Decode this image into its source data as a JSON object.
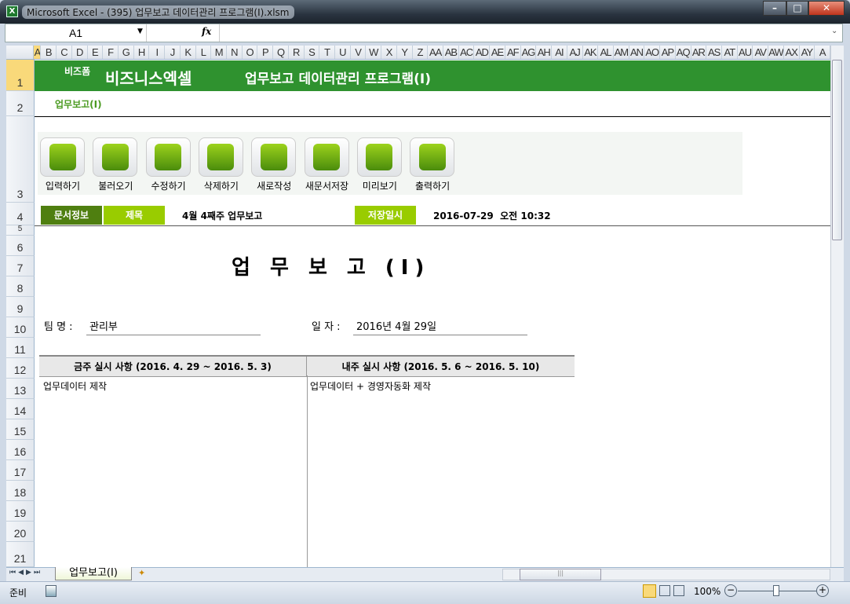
{
  "window": {
    "title": "Microsoft Excel - (395) 업무보고 데이터관리 프로그램(Ⅰ).xlsm",
    "app_icon": "X",
    "minimize": "–",
    "maximize": "□",
    "close": "✕"
  },
  "formula_bar": {
    "name_box": "A1",
    "fx": "fx",
    "formula": ""
  },
  "columns": [
    "A",
    "B",
    "C",
    "D",
    "E",
    "F",
    "G",
    "H",
    "I",
    "J",
    "K",
    "L",
    "M",
    "N",
    "O",
    "P",
    "Q",
    "R",
    "S",
    "T",
    "U",
    "V",
    "W",
    "X",
    "Y",
    "Z",
    "AA",
    "AB",
    "AC",
    "AD",
    "AE",
    "AF",
    "AG",
    "AH",
    "AI",
    "AJ",
    "AK",
    "AL",
    "AM",
    "AN",
    "AO",
    "AP",
    "AQ",
    "AR",
    "AS",
    "AT",
    "AU",
    "AV",
    "AW",
    "AX",
    "AY",
    "A"
  ],
  "rows": [
    "1",
    "2",
    "3",
    "4",
    "5",
    "6",
    "7",
    "8",
    "9",
    "10",
    "11",
    "12",
    "13",
    "14",
    "15",
    "16",
    "17",
    "18",
    "19",
    "20",
    "21"
  ],
  "header": {
    "small": "비즈폼",
    "brand": "비즈니스엑셀",
    "title": "업무보고 데이터관리 프로그램(Ⅰ)",
    "subtitle": "업무보고(Ⅰ)"
  },
  "toolbar": [
    {
      "label": "입력하기",
      "icon": "pencil-icon"
    },
    {
      "label": "불러오기",
      "icon": "load-icon"
    },
    {
      "label": "수정하기",
      "icon": "refresh-icon"
    },
    {
      "label": "삭제하기",
      "icon": "trash-icon"
    },
    {
      "label": "새로작성",
      "icon": "new-icon"
    },
    {
      "label": "새문서저장",
      "icon": "save-icon"
    },
    {
      "label": "미리보기",
      "icon": "monitor-icon"
    },
    {
      "label": "출력하기",
      "icon": "print-icon"
    }
  ],
  "doc_info": {
    "section": "문서정보",
    "title_label": "제목",
    "title_value": "4월 4째주 업무보고",
    "saved_label": "저장일시",
    "saved_value": "2016-07-29  오전 10:32"
  },
  "colors": {
    "green_bar": "#2f922f",
    "dark_green": "#4f7f10",
    "light_green": "#99cc00"
  },
  "report": {
    "heading": "업 무 보 고 (Ⅰ)",
    "team_label": "팀 명 :",
    "team_value": "관리부",
    "date_label": "일 자 :",
    "date_value": "2016년 4월 29일",
    "this_week_header": "금주 실시 사항 (2016. 4. 29 ~ 2016. 5. 3)",
    "next_week_header": "내주 실시 사항 (2016. 5. 6 ~ 2016. 5. 10)",
    "this_week": "업무데이터 제작",
    "next_week": "업무데이터 + 경영자동화 제작"
  },
  "sheet_tab": "업무보고(Ⅰ)",
  "status": {
    "ready": "준비",
    "zoom": "100%"
  }
}
